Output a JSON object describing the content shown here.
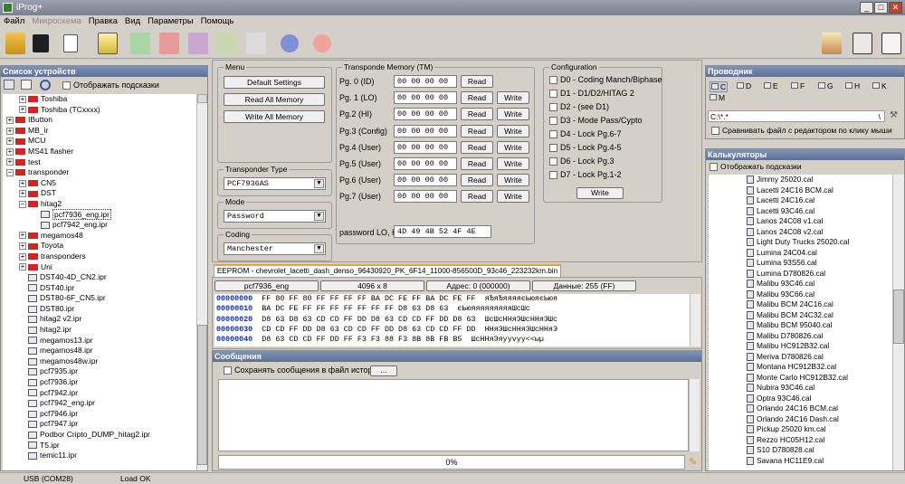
{
  "window": {
    "title": "iProg+"
  },
  "menu": [
    "Файл",
    "Микросхема",
    "Правка",
    "Вид",
    "Параметры",
    "Помощь"
  ],
  "left": {
    "title": "Список устройств",
    "show_hints": "Отображать подсказки",
    "tree": [
      {
        "label": "Toshiba",
        "indent": 1,
        "type": "folder",
        "exp": "+"
      },
      {
        "label": "Toshiba (TCxxxx)",
        "indent": 1,
        "type": "folder",
        "exp": "+"
      },
      {
        "label": "IButton",
        "indent": 0,
        "type": "folder",
        "exp": "+"
      },
      {
        "label": "MB_ir",
        "indent": 0,
        "type": "folder",
        "exp": "+"
      },
      {
        "label": "MCU",
        "indent": 0,
        "type": "folder",
        "exp": "+"
      },
      {
        "label": "MS41 flasher",
        "indent": 0,
        "type": "folder",
        "exp": "+"
      },
      {
        "label": "test",
        "indent": 0,
        "type": "folder",
        "exp": "+"
      },
      {
        "label": "transponder",
        "indent": 0,
        "type": "folder",
        "exp": "-"
      },
      {
        "label": "CN5",
        "indent": 1,
        "type": "folder",
        "exp": "+"
      },
      {
        "label": "DST",
        "indent": 1,
        "type": "folder",
        "exp": "+"
      },
      {
        "label": "hitag2",
        "indent": 1,
        "type": "folder",
        "exp": "-"
      },
      {
        "label": "pcf7936_eng.ipr",
        "indent": 2,
        "type": "file",
        "sel": true
      },
      {
        "label": "pcf7942_eng.ipr",
        "indent": 2,
        "type": "file"
      },
      {
        "label": "megamos48",
        "indent": 1,
        "type": "folder",
        "exp": "+"
      },
      {
        "label": "Toyota",
        "indent": 1,
        "type": "folder",
        "exp": "+"
      },
      {
        "label": "transponders",
        "indent": 1,
        "type": "folder",
        "exp": "+"
      },
      {
        "label": "Uni",
        "indent": 1,
        "type": "folder",
        "exp": "+"
      },
      {
        "label": "DST40-4D_CN2.ipr",
        "indent": 1,
        "type": "file"
      },
      {
        "label": "DST40.ipr",
        "indent": 1,
        "type": "file"
      },
      {
        "label": "DST80-6F_CN5.ipr",
        "indent": 1,
        "type": "file"
      },
      {
        "label": "DST80.ipr",
        "indent": 1,
        "type": "file"
      },
      {
        "label": "hitag2 v2.ipr",
        "indent": 1,
        "type": "file"
      },
      {
        "label": "hitag2.ipr",
        "indent": 1,
        "type": "file"
      },
      {
        "label": "megamos13.ipr",
        "indent": 1,
        "type": "file"
      },
      {
        "label": "megamos48.ipr",
        "indent": 1,
        "type": "file"
      },
      {
        "label": "megamos48w.ipr",
        "indent": 1,
        "type": "file"
      },
      {
        "label": "pcf7935.ipr",
        "indent": 1,
        "type": "file"
      },
      {
        "label": "pcf7936.ipr",
        "indent": 1,
        "type": "file"
      },
      {
        "label": "pcf7942.ipr",
        "indent": 1,
        "type": "file"
      },
      {
        "label": "pcf7942_eng.ipr",
        "indent": 1,
        "type": "file"
      },
      {
        "label": "pcf7946.ipr",
        "indent": 1,
        "type": "file"
      },
      {
        "label": "pcf7947.ipr",
        "indent": 1,
        "type": "file"
      },
      {
        "label": "Podbor Cripto_DUMP_hitag2.ipr",
        "indent": 1,
        "type": "file"
      },
      {
        "label": "T5.ipr",
        "indent": 1,
        "type": "file"
      },
      {
        "label": "temic11.ipr",
        "indent": 1,
        "type": "file"
      }
    ]
  },
  "menu_group": {
    "title": "Menu",
    "default": "Default Settings",
    "read_all": "Read All Memory",
    "write_all": "Write All Memory"
  },
  "transponder_type": {
    "title": "Transponder Type",
    "value": "PCF7936AS"
  },
  "mode": {
    "title": "Mode",
    "value": "Password"
  },
  "coding": {
    "title": "Coding",
    "value": "Manchester"
  },
  "tm": {
    "title": "Transponde Memory (TM)",
    "read": "Read",
    "write": "Write",
    "rows": [
      {
        "label": "Pg. 0 (ID)",
        "value": "00 00 00 00",
        "write": false
      },
      {
        "label": "Pg. 1 (LO)",
        "value": "00 00 00 00",
        "write": true
      },
      {
        "label": "Pg.2 (HI)",
        "value": "00 00 00 00",
        "write": true
      },
      {
        "label": "Pg.3 (Config)",
        "value": "00 00 00 00",
        "write": true
      },
      {
        "label": "Pg.4 (User)",
        "value": "00 00 00 00",
        "write": true
      },
      {
        "label": "Pg.5 (User)",
        "value": "00 00 00 00",
        "write": true
      },
      {
        "label": "Pg.6 (User)",
        "value": "00 00 00 00",
        "write": true
      },
      {
        "label": "Pg.7 (User)",
        "value": "00 00 00 00",
        "write": true
      }
    ],
    "password_label": "password LO, HI",
    "password_value": "4D 49 4B 52 4F 4E"
  },
  "config": {
    "title": "Configuration",
    "items": [
      "D0 - Coding Manch/Biphase",
      "D1 - D1/D2/HITAG 2",
      "D2 - (see D1)",
      "D3 - Mode Pass/Cypto",
      "D4 - Lock Pg.6-7",
      "D5 - Lock Pg.4-5",
      "D6 - Lock Pg.3",
      "D7 - Lock Pg.1-2"
    ],
    "write": "Write"
  },
  "eeprom": {
    "tab": "EEPROM - chevrolet_lacetti_dash_denso_96430920_PK_6F14_11000-856500D_93c46_223232km.bin",
    "info": [
      "pcf7936_eng",
      "4096 x 8",
      "Адрес: 0 (000000)",
      "Данные: 255 (FF)"
    ],
    "rows": [
      {
        "addr": "00000000",
        "hex": "FF 80 FF 80 FF FF FF FF BA DC FE FF BA DC FE FF",
        "ascii": "яЂяЂяяяяєЬюяєЬюя"
      },
      {
        "addr": "00000010",
        "hex": "BA DC FE FF FF FF FF FF FF FF D8 63 D8 63",
        "ascii": "єЬюяяяяяяяяяШcШc"
      },
      {
        "addr": "00000020",
        "hex": "D8 63 D8 63 CD CD FF DD D8 63 CD CD FF DD D8 63",
        "ascii": "ШcШcННяЭШcННяЭШc"
      },
      {
        "addr": "00000030",
        "hex": "CD CD FF DD D8 63 CD CD FF DD D8 63 CD CD FF DD",
        "ascii": "ННяЭШcННяЭШcННяЭ"
      },
      {
        "addr": "00000040",
        "hex": "D8 63 CD CD FF DD FF F3 F3 88 F3 8B 8B FB B5",
        "ascii": "ШcННяЭяууvyу<<ыµ"
      }
    ]
  },
  "messages": {
    "title": "Сообщения",
    "save": "Сохранять сообщения в файл истории",
    "browse": "...",
    "progress": "0%",
    "progress_value": 0
  },
  "explorer": {
    "title": "Проводник",
    "drives": [
      "C",
      "D",
      "E",
      "F",
      "G",
      "H",
      "K",
      "M"
    ],
    "path": "C:\\*.*",
    "path_tail": "\\",
    "compare": "Сравнивать файл с редактором по клику мыши"
  },
  "calc": {
    "title": "Калькуляторы",
    "show_hints": "Отображать подсказки",
    "items": [
      "Jimmy 25020.cal",
      "Lacetti 24C16 BCM.cal",
      "Lacetti 24C16.cal",
      "Lacetti 93C46.cal",
      "Lanos 24C08 v1.cal",
      "Lanos 24C08 v2.cal",
      "Light Duty Trucks 25020.cal",
      "Lumina 24C04.cal",
      "Lumina 93S56.cal",
      "Lumina D780826.cal",
      "Malibu 93C46.cal",
      "Malibu 93C66.cal",
      "Malibu BCM 24C16.cal",
      "Malibu BCM 24C32.cal",
      "Malibu BCM 95040.cal",
      "Malibu D780826.cal",
      "Malibu HC912B32.cal",
      "Meriva D780826.cal",
      "Montana HC912B32.cal",
      "Monte Carlo HC912B32.cal",
      "Nubira 93C46.cal",
      "Optra 93C46.cal",
      "Orlando 24C16 BCM.cal",
      "Orlando 24C16 Dash.cal",
      "Pickup 25020 km.cal",
      "Rezzo HC05H12.cal",
      "S10 D780828.cal",
      "Savana HC11E9.cal"
    ]
  },
  "status": {
    "port": "USB (COM28)",
    "state": "Load OK"
  }
}
